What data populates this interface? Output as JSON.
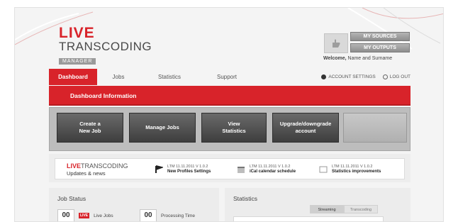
{
  "header": {
    "logo_live": "LIVE",
    "logo_transcoding": "TRANSCODING",
    "logo_manager": "MANAGER",
    "sources_label": "MY SOURCES",
    "outputs_label": "MY OUTPUTS",
    "welcome_prefix": "Welcome,",
    "welcome_name": "Name and Surname"
  },
  "nav": {
    "tabs": [
      {
        "label": "Dashboard",
        "active": true
      },
      {
        "label": "Jobs"
      },
      {
        "label": "Statistics"
      },
      {
        "label": "Support"
      }
    ],
    "account_settings": "ACCOUNT SETTINGS",
    "log_out": "LOG OUT"
  },
  "dashboard_bar": {
    "title": "Dashboard Information"
  },
  "actions": [
    {
      "label_line1": "Create a",
      "label_line2": "New Job"
    },
    {
      "label_line1": "Manage Jobs",
      "label_line2": ""
    },
    {
      "label_line1": "View",
      "label_line2": "Statistics"
    },
    {
      "label_line1": "Upgrade/downgrade",
      "label_line2": "account"
    }
  ],
  "news": {
    "logo_live": "LIVE",
    "logo_transcoding": "TRANSCODING",
    "subtitle": "Updates & news",
    "items": [
      {
        "meta": "LTM 11.11.2011 V 1.0.2",
        "title": "New Profiles Settings",
        "icon": "flag-icon"
      },
      {
        "meta": "LTM 11.11.2011 V 1.0.2",
        "title": "iCal calendar schedule",
        "icon": "calendar-icon"
      },
      {
        "meta": "LTM 11.11.2011 V 1.0.2",
        "title": "Statistics improvements",
        "icon": "chart-icon"
      }
    ]
  },
  "job_status": {
    "title": "Job Status",
    "live_count": "00",
    "live_badge": "LIVE",
    "live_label": "Live Jobs",
    "processing_count": "00",
    "processing_label": "Processing Time"
  },
  "statistics": {
    "title": "Statistics",
    "tab_streaming": "Streaming",
    "tab_transcoding": "Transcoding"
  },
  "colors": {
    "accent": "#d8232a",
    "dark_button": "#4a4a4a"
  }
}
